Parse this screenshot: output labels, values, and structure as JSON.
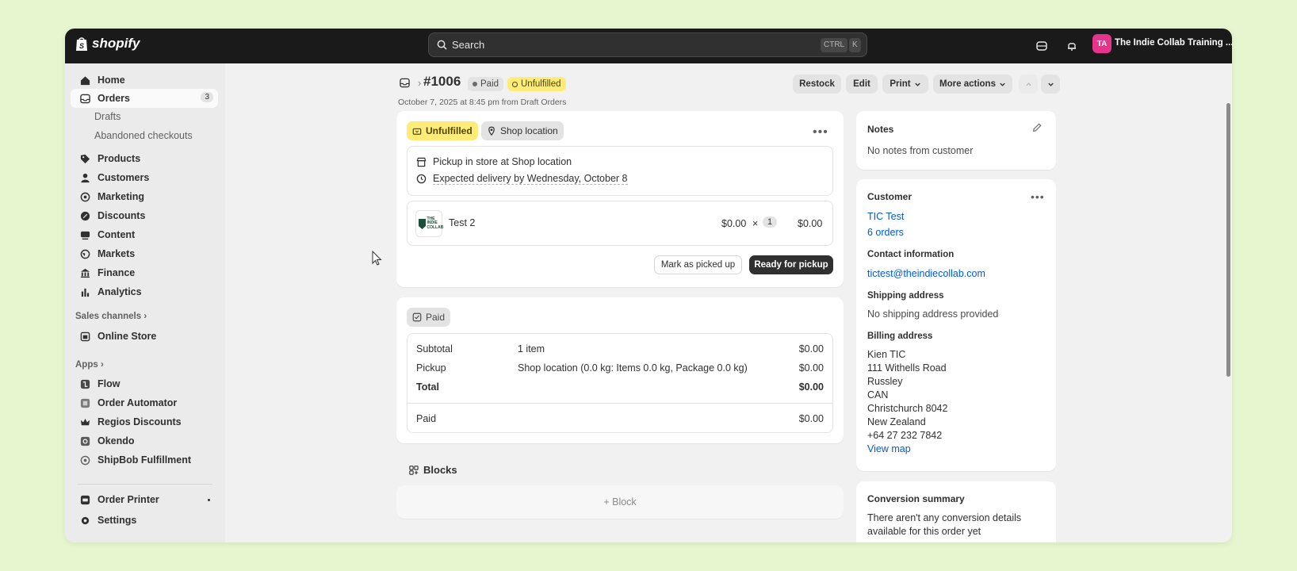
{
  "topbar": {
    "brand": "shopify",
    "search_placeholder": "Search",
    "kbd_ctrl": "CTRL",
    "kbd_k": "K",
    "avatar_initials": "TA",
    "store_name": "The Indie Collab Training ..."
  },
  "sidebar": {
    "home": "Home",
    "orders": "Orders",
    "orders_count": "3",
    "drafts": "Drafts",
    "abandoned": "Abandoned checkouts",
    "products": "Products",
    "customers": "Customers",
    "marketing": "Marketing",
    "discounts": "Discounts",
    "content": "Content",
    "markets": "Markets",
    "finance": "Finance",
    "analytics": "Analytics",
    "sales_channels": "Sales channels",
    "online_store": "Online Store",
    "apps": "Apps",
    "flow": "Flow",
    "order_automator": "Order Automator",
    "regios": "Regios Discounts",
    "okendo": "Okendo",
    "shipbob": "ShipBob Fulfillment",
    "order_printer": "Order Printer",
    "settings": "Settings"
  },
  "header": {
    "order_number": "#1006",
    "paid_badge": "Paid",
    "unfulfilled_badge": "Unfulfilled",
    "subtitle": "October 7, 2025 at 8:45 pm from Draft Orders",
    "restock": "Restock",
    "edit": "Edit",
    "print": "Print",
    "more_actions": "More actions"
  },
  "fulfillment": {
    "status": "Unfulfilled",
    "location": "Shop location",
    "pickup_line": "Pickup in store at Shop location",
    "delivery_line": "Expected delivery by Wednesday, October 8",
    "product_logo_text": "THE INDIE COLLAB",
    "product_name": "Test 2",
    "unit_price": "$0.00",
    "times": "×",
    "quantity": "1",
    "line_total": "$0.00",
    "mark_picked_up": "Mark as picked up",
    "ready_for_pickup": "Ready for pickup"
  },
  "payment": {
    "status": "Paid",
    "subtotal_label": "Subtotal",
    "subtotal_desc": "1 item",
    "subtotal_value": "$0.00",
    "pickup_label": "Pickup",
    "pickup_desc": "Shop location (0.0 kg: Items 0.0 kg, Package 0.0 kg)",
    "pickup_value": "$0.00",
    "total_label": "Total",
    "total_value": "$0.00",
    "paid_label": "Paid",
    "paid_value": "$0.00"
  },
  "blocks": {
    "title": "Blocks",
    "add_block": "+ Block"
  },
  "notes": {
    "title": "Notes",
    "text": "No notes from customer"
  },
  "customer": {
    "title": "Customer",
    "name": "TIC Test",
    "orders": "6 orders",
    "contact_title": "Contact information",
    "email": "tictest@theindiecollab.com",
    "shipping_title": "Shipping address",
    "shipping_text": "No shipping address provided",
    "billing_title": "Billing address",
    "billing_lines": [
      "Kien TIC",
      "111 Withells Road",
      "Russley",
      "CAN",
      "Christchurch 8042",
      "New Zealand",
      "+64 27 232 7842"
    ],
    "view_map": "View map"
  },
  "conversion": {
    "title": "Conversion summary",
    "text_line1": "There aren't any conversion details",
    "text_line2": "available for this order yet"
  },
  "colors": {
    "topbar": "#1a1a1a",
    "unfulfilled_bg": "#ffeb78",
    "link": "#005bd3",
    "primary_button": "#303030"
  }
}
